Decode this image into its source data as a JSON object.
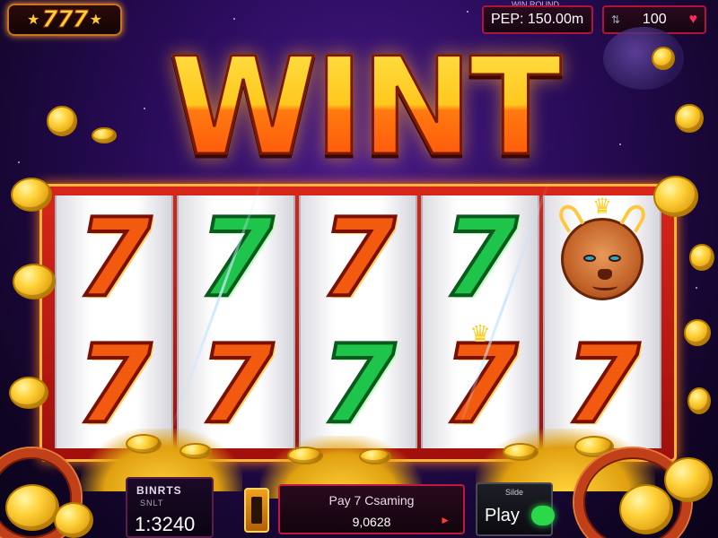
{
  "header": {
    "logo_text": "777",
    "logo_left_star": "★",
    "logo_right_star": "★",
    "win_caption": "WIN ROUND",
    "win_text": "PEP: 150.00m",
    "credits_icon": "tab-icon",
    "credits_value": "100",
    "heart_icon": "heart-icon"
  },
  "title": "WINT",
  "reels": [
    [
      {
        "type": "seven",
        "color": "red"
      },
      {
        "type": "seven",
        "color": "red"
      }
    ],
    [
      {
        "type": "seven",
        "color": "green"
      },
      {
        "type": "seven",
        "color": "red"
      }
    ],
    [
      {
        "type": "seven",
        "color": "red"
      },
      {
        "type": "seven",
        "color": "green"
      }
    ],
    [
      {
        "type": "seven",
        "color": "green"
      },
      {
        "type": "seven",
        "color": "red",
        "crown": true
      }
    ],
    [
      {
        "type": "lion"
      },
      {
        "type": "seven",
        "color": "red"
      }
    ]
  ],
  "symbols": {
    "seven": "7",
    "crown": "♛",
    "arrow": "►",
    "play_caption": "Silde"
  },
  "bottom": {
    "bet_label": "BINRTS",
    "bet_sub": "SNLT",
    "bet_value": "1:3240",
    "status_title": "Pay 7 Csaming",
    "status_value": "9,0628",
    "play_label": "Play"
  },
  "colors": {
    "accent_red": "#c0183e",
    "gold": "#ffd23a",
    "seven_red": "#f25a10",
    "seven_green": "#1fc44a",
    "play_toggle": "#2ad84a"
  }
}
